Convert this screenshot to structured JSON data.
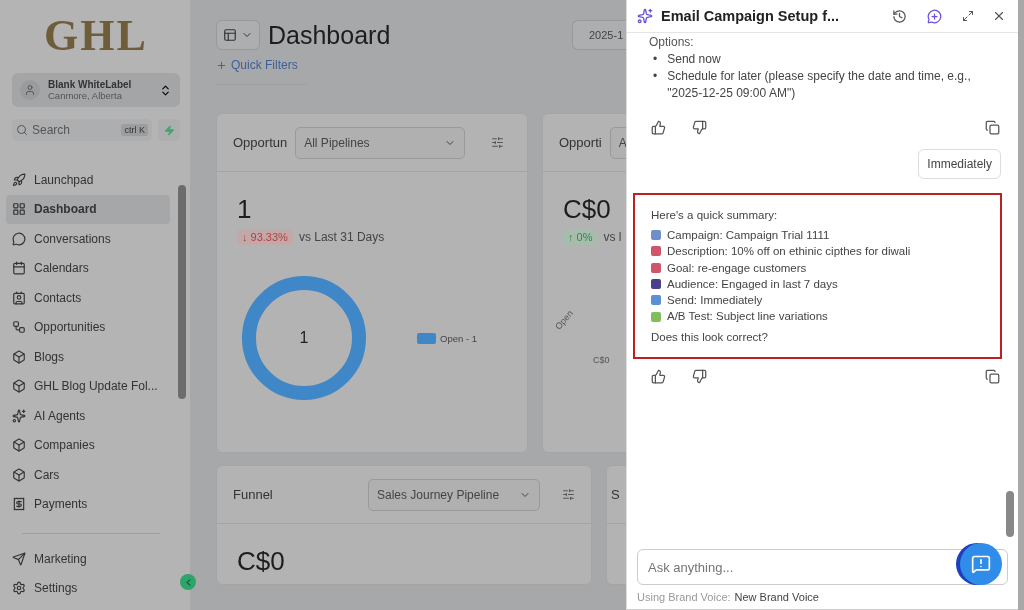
{
  "sidebar": {
    "logo": "GHL",
    "account": {
      "name": "Blank WhiteLabel",
      "location": "Canmore, Alberta"
    },
    "search": {
      "placeholder": "Search",
      "shortcut": "ctrl K"
    },
    "items": [
      {
        "label": "Launchpad",
        "selected": false
      },
      {
        "label": "Dashboard",
        "selected": true
      },
      {
        "label": "Conversations",
        "selected": false
      },
      {
        "label": "Calendars",
        "selected": false
      },
      {
        "label": "Contacts",
        "selected": false
      },
      {
        "label": "Opportunities",
        "selected": false
      },
      {
        "label": "Blogs",
        "selected": false
      },
      {
        "label": "GHL Blog Update Fol...",
        "selected": false
      },
      {
        "label": "AI Agents",
        "selected": false
      },
      {
        "label": "Companies",
        "selected": false
      },
      {
        "label": "Cars",
        "selected": false
      },
      {
        "label": "Payments",
        "selected": false
      }
    ],
    "bottom_items": [
      {
        "label": "Marketing"
      },
      {
        "label": "Settings"
      }
    ]
  },
  "header": {
    "title": "Dashboard",
    "date": "2025-1",
    "quick_filters": "Quick Filters"
  },
  "cards": [
    {
      "title": "Opportun",
      "select": "All Pipelines",
      "value": "1",
      "change": "↓ 93.33%",
      "negative": true,
      "compare": "vs Last 31 Days",
      "donut_center": "1",
      "legend": "Open - 1"
    },
    {
      "title": "Opporti",
      "select": "A",
      "value": "C$0",
      "change": "↑ 0%",
      "negative": false,
      "compare": "vs l",
      "axis_label": "Open",
      "tick_label": "C$0"
    }
  ],
  "funnel": {
    "title": "Funnel",
    "select": "Sales Journey Pipeline",
    "value": "C$0",
    "next_title": "S"
  },
  "chat": {
    "title": "Email Campaign Setup f...",
    "intro": "Options:",
    "bullet": "•",
    "options": [
      "Send now",
      "Schedule for later (please specify the date and time, e.g., \"2025-12-25 09:00 AM\")"
    ],
    "user_reply": "Immediately",
    "summary_title": "Here's a quick summary:",
    "summary": [
      {
        "text": "Campaign: Campaign Trial 1111",
        "color": "#6f8fc8"
      },
      {
        "text": "Description: 10% off on ethinic cipthes for diwali",
        "color": "#d0546a"
      },
      {
        "text": "Goal: re-engage customers",
        "color": "#d0546a"
      },
      {
        "text": "Audience: Engaged in last 7 days",
        "color": "#4a3f8c"
      },
      {
        "text": "Send: Immediately",
        "color": "#5b8fd6"
      },
      {
        "text": "A/B Test: Subject line variations",
        "color": "#7fbf5a"
      }
    ],
    "question": "Does this look correct?",
    "input": {
      "placeholder": "Ask anything..."
    },
    "brand_voice_label": "Using Brand Voice:",
    "brand_voice": "New Brand Voice"
  }
}
